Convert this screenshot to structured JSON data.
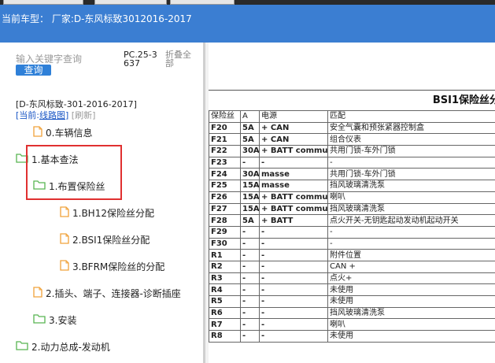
{
  "header": {
    "model_label": "当前车型： 厂家:D-东风标致3012016-2017"
  },
  "sidebar": {
    "search_placeholder": "输入关键字查询",
    "search_button": "查询",
    "pc_code": "PC.25-3637",
    "collapse_all": "折叠全部",
    "vehicle": "[D-东风标致-301-2016-2017]",
    "current_label": "[当前:",
    "current_link": "线路图",
    "close_bracket": "]",
    "refresh": "[刷新]"
  },
  "tree": [
    {
      "label": "0.车辆信息",
      "icon": "file-icon"
    },
    {
      "label": "1.基本查法",
      "icon": "folder-icon"
    },
    {
      "label": "1.布置保险丝",
      "icon": "folder-icon"
    },
    {
      "label": "1.BH12保险丝分配",
      "icon": "file-icon"
    },
    {
      "label": "2.BSI1保险丝分配",
      "icon": "file-icon"
    },
    {
      "label": "3.BFRM保险丝的分配",
      "icon": "file-icon"
    },
    {
      "label": "2.插头、端子、连接器-诊断插座",
      "icon": "file-icon"
    },
    {
      "label": "3.安装",
      "icon": "folder-icon"
    },
    {
      "label": "2.动力总成-发动机",
      "icon": "folder-icon"
    }
  ],
  "document": {
    "title": "BSI1保险丝分",
    "headers": [
      "保险丝",
      "A",
      "电源",
      "匹配"
    ],
    "rows": [
      [
        "F20",
        "5A",
        "+ CAN",
        "安全气囊和预张紧器控制盒"
      ],
      [
        "F21",
        "5A",
        "+ CAN",
        "组合仪表"
      ],
      [
        "F22",
        "30A",
        "+ BATT commut□□",
        "共用门锁-车外门锁"
      ],
      [
        "F23",
        "-",
        "-",
        "-"
      ],
      [
        "F24",
        "30A",
        "masse",
        "共用门锁-车外门锁"
      ],
      [
        "F25",
        "15A",
        "masse",
        "挡风玻璃清洗泵"
      ],
      [
        "F26",
        "15A",
        "+ BATT commut□□",
        "喇叭"
      ],
      [
        "F27",
        "15A",
        "+ BATT commut□□",
        "挡风玻璃清洗泵"
      ],
      [
        "F28",
        "5A",
        "+ BATT",
        "点火开关-无钥匙起动发动机起动开关"
      ],
      [
        "F29",
        "-",
        "-",
        "-"
      ],
      [
        "F30",
        "-",
        "-",
        "-"
      ],
      [
        "R1",
        "-",
        "-",
        "附件位置"
      ],
      [
        "R2",
        "-",
        "-",
        "CAN +"
      ],
      [
        "R3",
        "-",
        "-",
        "点火+"
      ],
      [
        "R4",
        "-",
        "-",
        "未使用"
      ],
      [
        "R5",
        "-",
        "-",
        "未使用"
      ],
      [
        "R6",
        "-",
        "-",
        "挡风玻璃清洗泵"
      ],
      [
        "R7",
        "-",
        "-",
        "喇叭"
      ],
      [
        "R8",
        "-",
        "-",
        "未使用"
      ]
    ]
  },
  "colors": {
    "header_bg": "#3b7ed2",
    "link": "#1b57c5",
    "highlight": "#e03030",
    "folder": "#58b552",
    "file": "#f0a23a"
  }
}
